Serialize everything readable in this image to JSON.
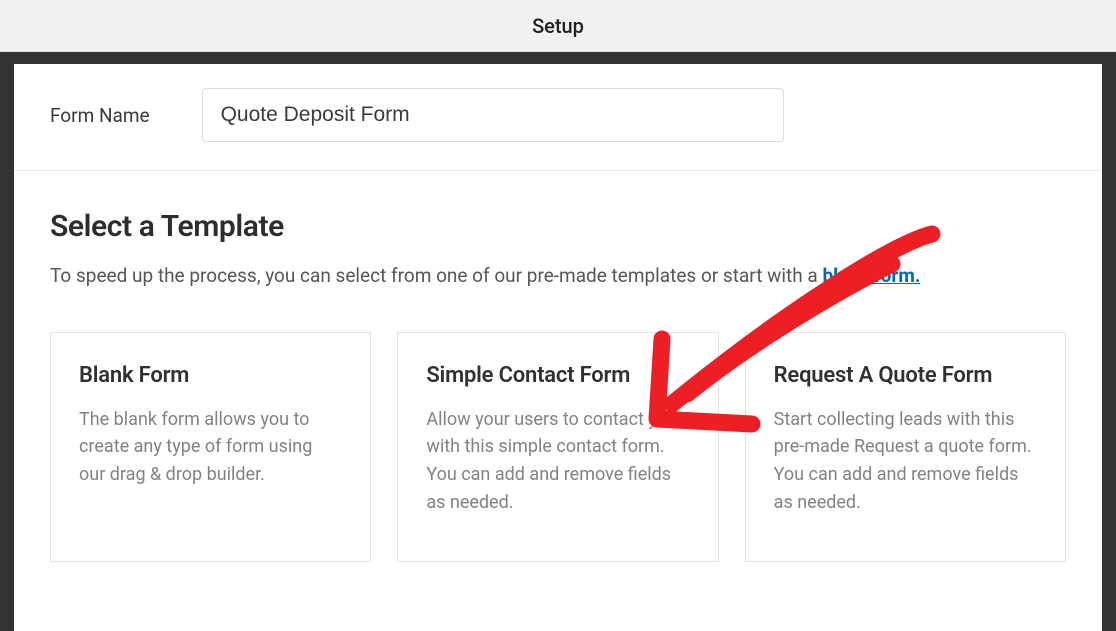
{
  "header": {
    "title": "Setup"
  },
  "formName": {
    "label": "Form Name",
    "value": "Quote Deposit Form"
  },
  "template": {
    "heading": "Select a Template",
    "subtext_pre": "To speed up the process, you can select from one of our pre-made templates or start with a ",
    "subtext_link": "blank form.",
    "cards": [
      {
        "title": "Blank Form",
        "desc": "The blank form allows you to create any type of form using our drag & drop builder."
      },
      {
        "title": "Simple Contact Form",
        "desc": "Allow your users to contact you with this simple contact form. You can add and remove fields as needed."
      },
      {
        "title": "Request A Quote Form",
        "desc": "Start collecting leads with this pre-made Request a quote form. You can add and remove fields as needed."
      }
    ]
  }
}
